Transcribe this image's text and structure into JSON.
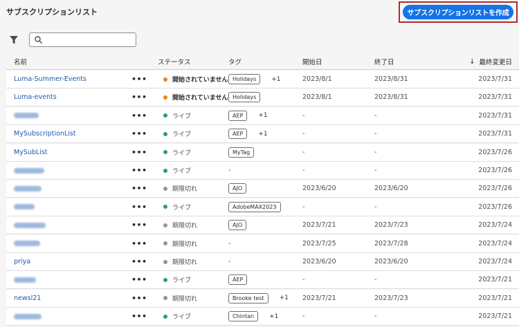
{
  "title": "サブスクリプションリスト",
  "create_button_label": "サブスクリプションリストを作成",
  "search": {
    "value": "",
    "placeholder": ""
  },
  "columns": {
    "name": "名前",
    "status": "ステータス",
    "tags": "タグ",
    "start": "開始日",
    "end": "終了日",
    "modified": "最終変更日"
  },
  "more_label": "•••",
  "status_colors": {
    "not_started": "#e68619",
    "live": "#2d9d78",
    "expired": "#959595"
  },
  "rows": [
    {
      "name": "Luma-Summer-Events",
      "blurred": false,
      "status": "開始されていません",
      "status_type": "not_started",
      "tag": "Holidays",
      "more_tags": "+1",
      "start": "2023/8/1",
      "end": "2023/8/31",
      "modified": "2023/7/31"
    },
    {
      "name": "Luma-events",
      "blurred": false,
      "status": "開始されていません",
      "status_type": "not_started",
      "tag": "Holidays",
      "more_tags": "",
      "start": "2023/8/1",
      "end": "2023/8/31",
      "modified": "2023/7/31"
    },
    {
      "name": "",
      "blurred": true,
      "status": "ライブ",
      "status_type": "live",
      "tag": "AEP",
      "more_tags": "+1",
      "start": "-",
      "end": "-",
      "modified": "2023/7/31"
    },
    {
      "name": "MySubscriptionList",
      "blurred": false,
      "status": "ライブ",
      "status_type": "live",
      "tag": "AEP",
      "more_tags": "+1",
      "start": "-",
      "end": "-",
      "modified": "2023/7/31"
    },
    {
      "name": "MySubList",
      "blurred": false,
      "status": "ライブ",
      "status_type": "live",
      "tag": "MyTag",
      "more_tags": "",
      "start": "-",
      "end": "-",
      "modified": "2023/7/26"
    },
    {
      "name": "",
      "blurred": true,
      "status": "ライブ",
      "status_type": "live",
      "tag": "",
      "more_tags": "",
      "start": "-",
      "end": "-",
      "modified": "2023/7/26"
    },
    {
      "name": "",
      "blurred": true,
      "status": "期限切れ",
      "status_type": "expired",
      "tag": "AJO",
      "more_tags": "",
      "start": "2023/6/20",
      "end": "2023/6/20",
      "modified": "2023/7/26"
    },
    {
      "name": "",
      "blurred": true,
      "status": "ライブ",
      "status_type": "live",
      "tag": "AdobeMAX2023",
      "more_tags": "",
      "start": "-",
      "end": "-",
      "modified": "2023/7/26"
    },
    {
      "name": "",
      "blurred": true,
      "status": "期限切れ",
      "status_type": "expired",
      "tag": "AJO",
      "more_tags": "",
      "start": "2023/7/21",
      "end": "2023/7/23",
      "modified": "2023/7/24"
    },
    {
      "name": "",
      "blurred": true,
      "status": "期限切れ",
      "status_type": "expired",
      "tag": "",
      "more_tags": "",
      "start": "2023/7/25",
      "end": "2023/7/28",
      "modified": "2023/7/24"
    },
    {
      "name": "priya",
      "blurred": false,
      "status": "期限切れ",
      "status_type": "expired",
      "tag": "",
      "more_tags": "",
      "start": "2023/6/20",
      "end": "2023/6/20",
      "modified": "2023/7/24"
    },
    {
      "name": "",
      "blurred": true,
      "status": "ライブ",
      "status_type": "live",
      "tag": "AEP",
      "more_tags": "",
      "start": "-",
      "end": "-",
      "modified": "2023/7/21"
    },
    {
      "name": "newsl21",
      "blurred": false,
      "status": "期限切れ",
      "status_type": "expired",
      "tag": "Brooke test",
      "more_tags": "+1",
      "start": "2023/7/21",
      "end": "2023/7/23",
      "modified": "2023/7/21"
    },
    {
      "name": "",
      "blurred": true,
      "status": "ライブ",
      "status_type": "live",
      "tag": "Chintan",
      "more_tags": "+1",
      "start": "-",
      "end": "-",
      "modified": "2023/7/21"
    }
  ]
}
